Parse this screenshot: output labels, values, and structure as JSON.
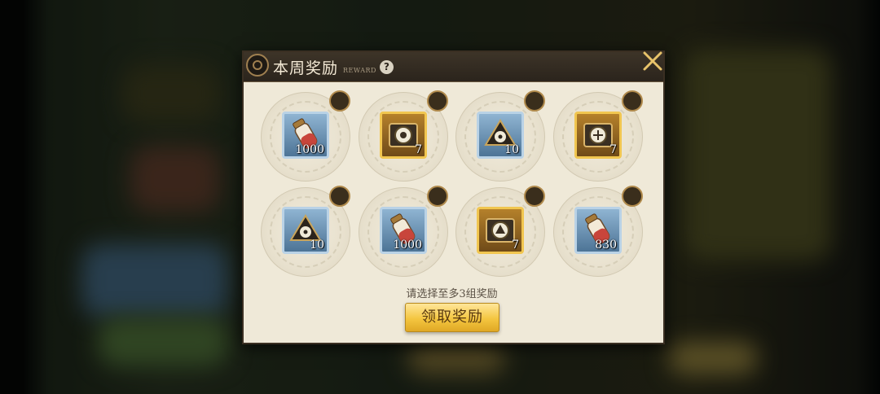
{
  "dialog": {
    "title": "本周奖励",
    "subtitle": "REWARD",
    "help_label": "?",
    "hint": "请选择至多3组奖励",
    "claim_label": "领取奖励"
  },
  "rewards": [
    {
      "quantity": "1000",
      "rarity": "blue",
      "icon": "potion-icon"
    },
    {
      "quantity": "7",
      "rarity": "gold",
      "icon": "gear-token-icon"
    },
    {
      "quantity": "10",
      "rarity": "blue",
      "icon": "gear-token-icon"
    },
    {
      "quantity": "7",
      "rarity": "gold",
      "icon": "gear-token-icon"
    },
    {
      "quantity": "10",
      "rarity": "blue",
      "icon": "gear-token-icon"
    },
    {
      "quantity": "1000",
      "rarity": "blue",
      "icon": "potion-icon"
    },
    {
      "quantity": "7",
      "rarity": "gold",
      "icon": "gear-token-icon"
    },
    {
      "quantity": "830",
      "rarity": "blue",
      "icon": "potion-icon"
    }
  ]
}
